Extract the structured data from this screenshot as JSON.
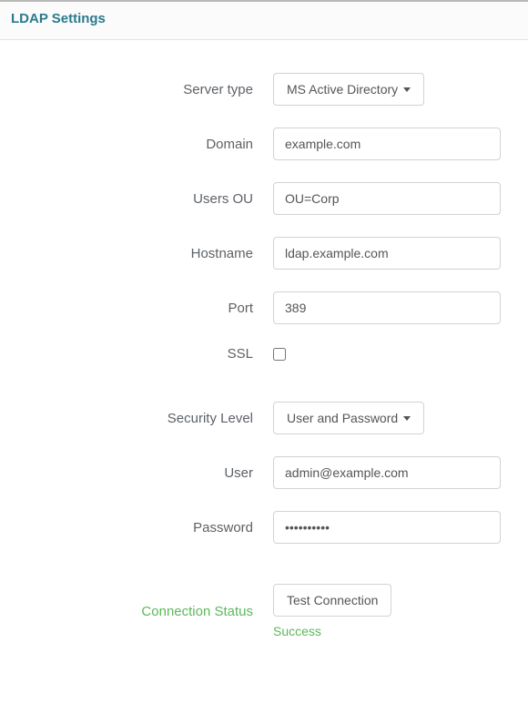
{
  "header": {
    "title": "LDAP Settings"
  },
  "form": {
    "server_type": {
      "label": "Server type",
      "value": "MS Active Directory"
    },
    "domain": {
      "label": "Domain",
      "value": "example.com"
    },
    "users_ou": {
      "label": "Users OU",
      "value": "OU=Corp"
    },
    "hostname": {
      "label": "Hostname",
      "value": "ldap.example.com"
    },
    "port": {
      "label": "Port",
      "value": "389"
    },
    "ssl": {
      "label": "SSL",
      "checked": false
    },
    "security_level": {
      "label": "Security Level",
      "value": "User and Password"
    },
    "user": {
      "label": "User",
      "value": "admin@example.com"
    },
    "password": {
      "label": "Password",
      "value": "••••••••••"
    },
    "connection_status": {
      "label": "Connection Status",
      "button": "Test Connection",
      "result": "Success"
    }
  }
}
